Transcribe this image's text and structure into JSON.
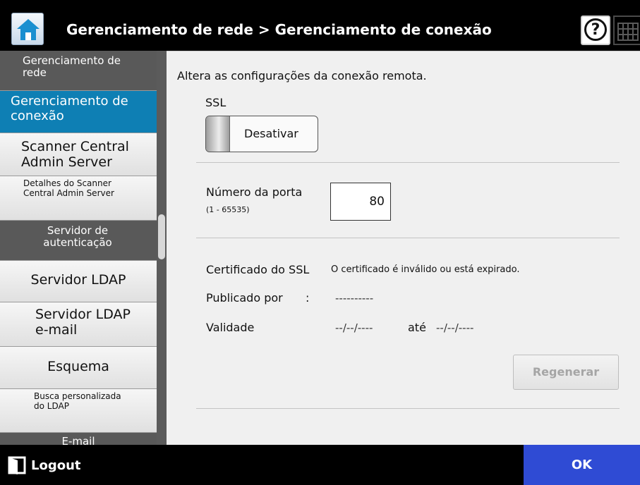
{
  "header": {
    "title": "Gerenciamento de rede > Gerenciamento de conexão",
    "home_icon": "home-icon",
    "help_icon": "help-icon",
    "keyboard_icon": "keyboard-icon"
  },
  "sidebar": {
    "items": [
      {
        "label": "Gerenciamento de rede"
      },
      {
        "label": "Gerenciamento de conexão",
        "active": true
      },
      {
        "label": "Scanner Central Admin Server"
      },
      {
        "label": "Detalhes do Scanner Central Admin Server"
      },
      {
        "label": "Servidor de autenticação"
      },
      {
        "label": "Servidor LDAP"
      },
      {
        "label": "Servidor LDAP e-mail"
      },
      {
        "label": "Esquema"
      },
      {
        "label": "Busca personalizada do LDAP"
      },
      {
        "label": "E-mail"
      }
    ]
  },
  "main": {
    "description": "Altera as configurações da conexão remota.",
    "ssl": {
      "label": "SSL",
      "toggle_value": "Desativar"
    },
    "port": {
      "label": "Número da porta",
      "range": "(1 - 65535)",
      "value": "80"
    },
    "certificate": {
      "label": "Certificado do SSL",
      "status": "O certificado é inválido ou está expirado.",
      "published_label": "Publicado por",
      "published_colon": ":",
      "published_value": "----------",
      "validity_label": "Validade",
      "validity_from": "--/--/----",
      "validity_sep": "até",
      "validity_to": "--/--/----"
    },
    "regenerate_label": "Regenerar"
  },
  "footer": {
    "logout_label": "Logout",
    "ok_label": "OK"
  },
  "colors": {
    "active_item": "#0e7fb4",
    "ok_button": "#2f4bd4",
    "section_header": "#595959"
  }
}
